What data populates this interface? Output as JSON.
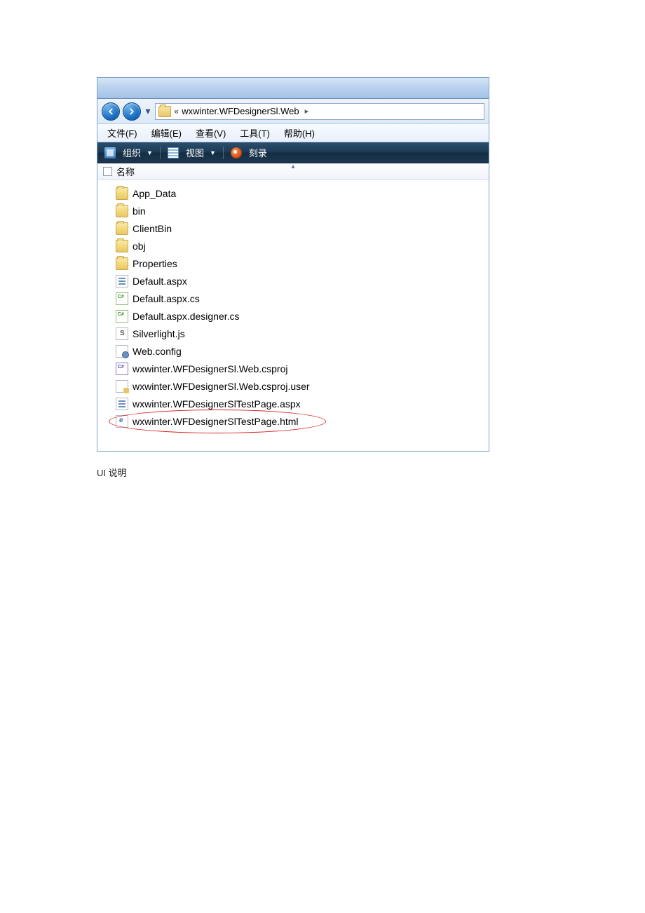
{
  "address": {
    "chevrons": "«",
    "path": "wxwinter.WFDesignerSl.Web",
    "arrow": "▸"
  },
  "menu": {
    "file": "文件(F)",
    "edit": "编辑(E)",
    "view": "查看(V)",
    "tools": "工具(T)",
    "help": "帮助(H)"
  },
  "toolbar": {
    "organize": "组织",
    "view": "视图",
    "burn": "刻录"
  },
  "columns": {
    "name": "名称"
  },
  "files": [
    {
      "name": "App_Data",
      "type": "folder"
    },
    {
      "name": "bin",
      "type": "folder"
    },
    {
      "name": "ClientBin",
      "type": "folder"
    },
    {
      "name": "obj",
      "type": "folder"
    },
    {
      "name": "Properties",
      "type": "folder"
    },
    {
      "name": "Default.aspx",
      "type": "aspx"
    },
    {
      "name": "Default.aspx.cs",
      "type": "cs"
    },
    {
      "name": "Default.aspx.designer.cs",
      "type": "cs"
    },
    {
      "name": "Silverlight.js",
      "type": "js"
    },
    {
      "name": "Web.config",
      "type": "config"
    },
    {
      "name": "wxwinter.WFDesignerSl.Web.csproj",
      "type": "csproj"
    },
    {
      "name": "wxwinter.WFDesignerSl.Web.csproj.user",
      "type": "user"
    },
    {
      "name": "wxwinter.WFDesignerSlTestPage.aspx",
      "type": "aspx"
    },
    {
      "name": "wxwinter.WFDesignerSlTestPage.html",
      "type": "html",
      "highlighted": true
    }
  ],
  "caption": "UI 说明"
}
